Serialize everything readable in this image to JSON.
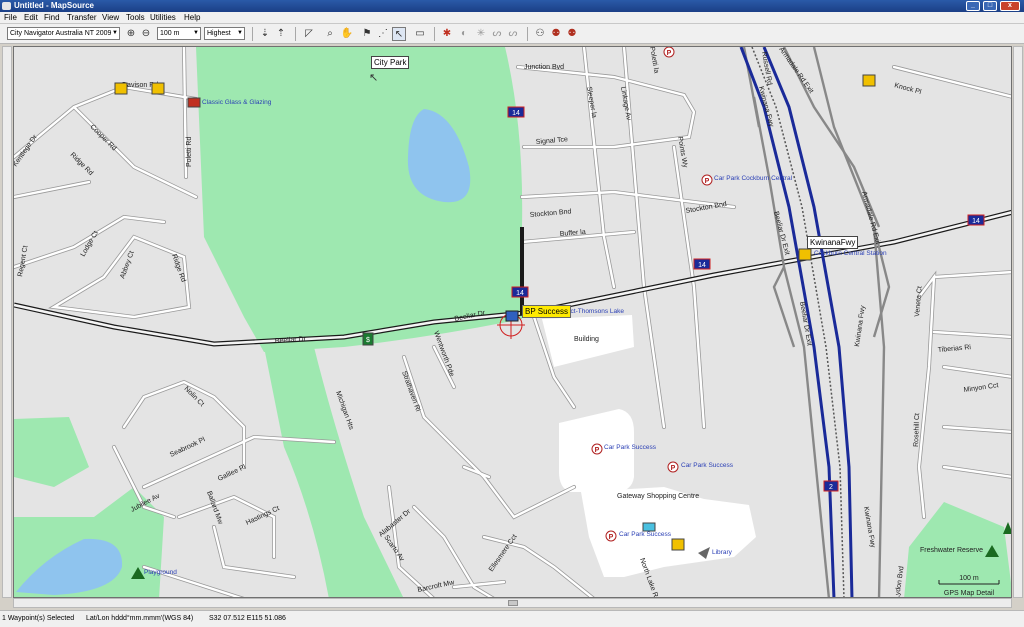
{
  "window": {
    "title": "Untitled - MapSource"
  },
  "menu": [
    "File",
    "Edit",
    "Find",
    "Transfer",
    "View",
    "Tools",
    "Utilities",
    "Help"
  ],
  "toolbar": {
    "map_product": "City Navigator Australia NT 2009",
    "zoom": "100 m",
    "detail": "Highest"
  },
  "map": {
    "park_label": "City Park",
    "callout_waypoint": "BP Success",
    "callout_highway": "KwinanaFwy",
    "scale_label": "100 m",
    "detail_label": "GPS Map Detail",
    "highway_shields": [
      "14",
      "14",
      "14",
      "14",
      "2"
    ],
    "streets": [
      "Davison Rd",
      "Cooper Rd",
      "Kentlege Dr",
      "Ridge Rd",
      "Poletti Rd",
      "Lodge Ct",
      "Abbey Ct",
      "Ridge Rd",
      "Regent Ct",
      "Junction Bvd",
      "Signal Tce",
      "Stockton Bnd",
      "Buffer la",
      "Sleeper la",
      "Linkage Av",
      "Points Wy",
      "Stockton Bnd",
      "Beeliar Dr",
      "Beeliar Dr",
      "Wentworth Pde",
      "Strathaven Ri",
      "Michigan Hts",
      "Nolin Ct",
      "Seabrook Pl",
      "Galilee Pl",
      "Jubilee Av",
      "Ballard Mw",
      "Hastings Ct",
      "Alabaster Dr",
      "Scarto Av",
      "Barcroft Mw",
      "Ellesmere Cct",
      "North Lake Rd",
      "Veneta Ct",
      "Tiberias Ri",
      "Minyon Cct",
      "Rosehill Ct",
      "Beeliar Dr Exit",
      "Beeliar Dr Exit",
      "Kwinana Fwy",
      "Kwinana Fwy",
      "Armadale Rd Exit",
      "Armadale Rd Exit",
      "Knock Pl",
      "Kwinana Fwy",
      "Lydon Bvd",
      "Russell Rd",
      "Poletti la",
      "Building"
    ],
    "pois": [
      "Classic Glass & Glazing",
      "Car Park Cockburn Central",
      "Cockburn Central Station",
      "Car Park Success",
      "Car Park Success",
      "Car Park Success",
      "Gateway Shopping Centre",
      "Library",
      "Playground",
      "Freshwater Reserve",
      "Tract-Thomsons Lake"
    ]
  },
  "status": {
    "selection": "1 Waypoint(s) Selected",
    "format": "Lat/Lon hddd°mm.mmm'(WGS 84)",
    "position": "S32 07.512 E115 51.086"
  },
  "colors": {
    "park": "#9ee8b0",
    "water": "#8fc4ee",
    "road_bg": "#e4e4e4",
    "road": "#ffffff",
    "freeway": "#1a2a99",
    "rail": "#555555"
  }
}
